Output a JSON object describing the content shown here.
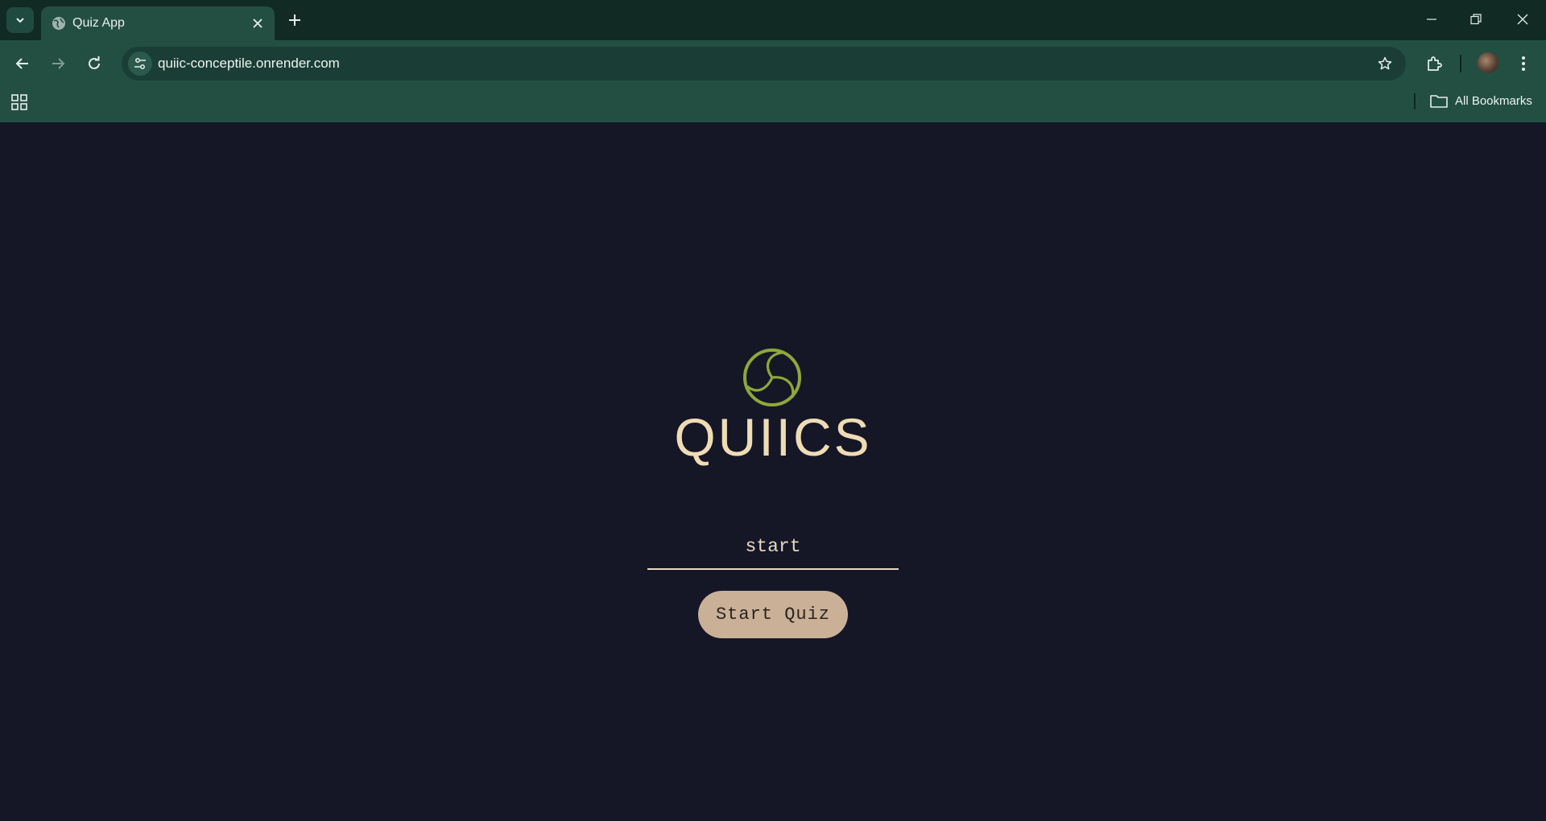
{
  "browser": {
    "tab": {
      "title": "Quiz App",
      "favicon": "globe-icon"
    },
    "address_bar": {
      "url": "quiic-conceptile.onrender.com"
    },
    "bookmarks_bar": {
      "all_bookmarks_label": "All Bookmarks"
    },
    "colors": {
      "frame": "#112a24",
      "toolbar": "#234f43",
      "omnibox": "#1a3e35"
    }
  },
  "page": {
    "logo": {
      "icon": "swirl-logo-icon",
      "color": "#8ea83a"
    },
    "brand_name": "QUIICS",
    "name_input": {
      "value": "start",
      "placeholder": ""
    },
    "start_button_label": "Start Quiz",
    "colors": {
      "background": "#151727",
      "accent": "#efdcb4",
      "button": "#c9b096"
    }
  }
}
